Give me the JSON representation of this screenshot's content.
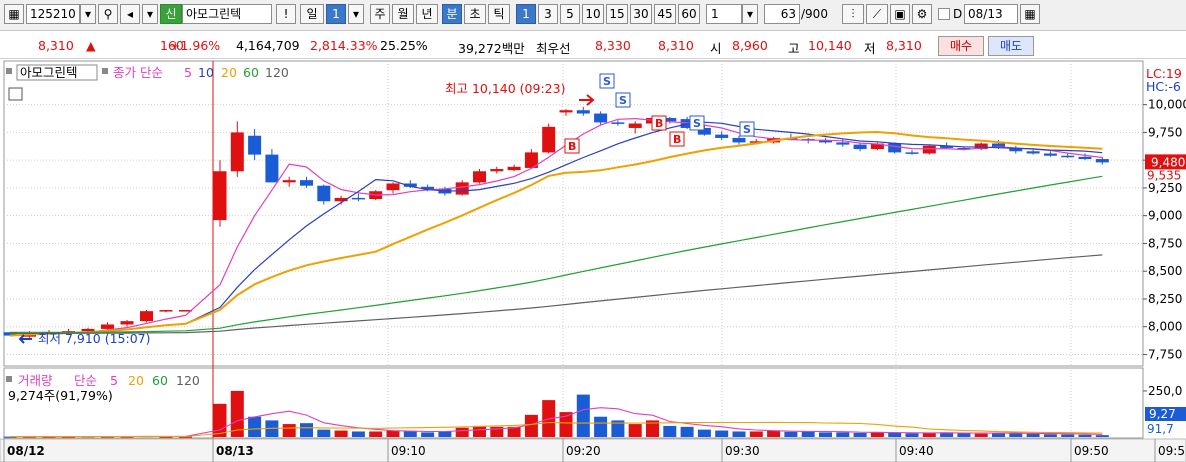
{
  "toolbar": {
    "code": "125210",
    "credit_badge": "신",
    "stock_name": "아모그린텍",
    "alert": "!",
    "period_tabs": [
      "일",
      "1",
      "주",
      "월",
      "년",
      "분",
      "초",
      "틱"
    ],
    "intervals": [
      "1",
      "3",
      "5",
      "10",
      "15",
      "30",
      "45",
      "60"
    ],
    "interval_value": "1",
    "count": "63",
    "count_max": "/900",
    "date_check": "D",
    "date": "08/13"
  },
  "quote": {
    "price": "8,310",
    "change_arrow": "▲",
    "change": "160",
    "change_pct": "+1.96%",
    "volume": "4,164,709",
    "vol_ratio": "2,814.33%",
    "turnover": "25.25%",
    "amount": "39,272백만",
    "best_label": "최우선",
    "best_ask": "8,330",
    "best_bid": "8,310",
    "open_label": "시",
    "open": "8,960",
    "high_label": "고",
    "high": "10,140",
    "low_label": "저",
    "low": "8,310",
    "buy": "매수",
    "sell": "매도"
  },
  "chart_data": {
    "type": "candlestick",
    "legend": {
      "name": "아모그린텍",
      "ma_label": "종가 단순",
      "ma_periods": [
        "5",
        "10",
        "20",
        "60",
        "120"
      ]
    },
    "colors": {
      "up": "#e01010",
      "down": "#1a5cd6",
      "ma5": "#e040c0",
      "ma10": "#2840c0",
      "ma20": "#f0a000",
      "ma60": "#20a030",
      "ma120": "#606060"
    },
    "price_axis": {
      "ticks": [
        "10,000",
        "9,750",
        "9,500",
        "9,250",
        "9,000",
        "8,750",
        "8,500",
        "8,250",
        "8,000",
        "7,750"
      ],
      "range": [
        7700,
        10150
      ],
      "current": "9,480",
      "current_sub": "9,535",
      "lc_label": "LC:19",
      "hc_label": "HC:-6"
    },
    "annotations": {
      "high": "최고 10,140 (09:23)",
      "low": "최저 7,910 (15:07)",
      "signals": [
        "S",
        "S",
        "S",
        "S",
        "B",
        "B",
        "B"
      ]
    },
    "x_labels": [
      "08/12",
      "08/13",
      "09:10",
      "09:20",
      "09:30",
      "09:40",
      "09:50",
      "09:5"
    ],
    "candles": [
      [
        7950,
        7950,
        7920,
        7920
      ],
      [
        7910,
        7960,
        7900,
        7940
      ],
      [
        7940,
        7970,
        7930,
        7950
      ],
      [
        7950,
        7980,
        7940,
        7960
      ],
      [
        7960,
        7990,
        7950,
        7980
      ],
      [
        7980,
        8040,
        7970,
        8020
      ],
      [
        8020,
        8060,
        8000,
        8050
      ],
      [
        8050,
        8150,
        8040,
        8140
      ],
      [
        8140,
        8150,
        8130,
        8150
      ],
      [
        8150,
        8150,
        8150,
        8150
      ],
      [
        8960,
        9500,
        8900,
        9400
      ],
      [
        9400,
        9850,
        9350,
        9750
      ],
      [
        9720,
        9780,
        9500,
        9550
      ],
      [
        9550,
        9600,
        9300,
        9300
      ],
      [
        9300,
        9350,
        9260,
        9320
      ],
      [
        9320,
        9350,
        9250,
        9270
      ],
      [
        9270,
        9280,
        9100,
        9130
      ],
      [
        9130,
        9180,
        9100,
        9160
      ],
      [
        9160,
        9200,
        9130,
        9150
      ],
      [
        9150,
        9230,
        9140,
        9220
      ],
      [
        9230,
        9300,
        9200,
        9290
      ],
      [
        9290,
        9320,
        9250,
        9260
      ],
      [
        9260,
        9280,
        9220,
        9240
      ],
      [
        9240,
        9260,
        9180,
        9200
      ],
      [
        9190,
        9320,
        9180,
        9300
      ],
      [
        9300,
        9420,
        9290,
        9400
      ],
      [
        9400,
        9440,
        9380,
        9420
      ],
      [
        9410,
        9460,
        9400,
        9440
      ],
      [
        9430,
        9600,
        9420,
        9570
      ],
      [
        9570,
        9830,
        9560,
        9800
      ],
      [
        9930,
        9960,
        9900,
        9950
      ],
      [
        9950,
        9980,
        9900,
        9920
      ],
      [
        9920,
        9940,
        9820,
        9840
      ],
      [
        9840,
        9860,
        9810,
        9830
      ],
      [
        9790,
        9850,
        9740,
        9830
      ],
      [
        9830,
        9890,
        9810,
        9880
      ],
      [
        9880,
        9890,
        9830,
        9850
      ],
      [
        9870,
        9890,
        9780,
        9790
      ],
      [
        9790,
        9820,
        9720,
        9730
      ],
      [
        9730,
        9760,
        9680,
        9700
      ],
      [
        9700,
        9720,
        9640,
        9660
      ],
      [
        9660,
        9690,
        9640,
        9670
      ],
      [
        9660,
        9710,
        9650,
        9700
      ],
      [
        9700,
        9740,
        9680,
        9690
      ],
      [
        9690,
        9700,
        9650,
        9680
      ],
      [
        9680,
        9700,
        9650,
        9660
      ],
      [
        9660,
        9690,
        9620,
        9640
      ],
      [
        9640,
        9660,
        9580,
        9600
      ],
      [
        9600,
        9660,
        9590,
        9650
      ],
      [
        9650,
        9660,
        9560,
        9570
      ],
      [
        9570,
        9590,
        9550,
        9560
      ],
      [
        9560,
        9640,
        9550,
        9630
      ],
      [
        9630,
        9660,
        9600,
        9610
      ],
      [
        9610,
        9620,
        9590,
        9600
      ],
      [
        9600,
        9660,
        9590,
        9650
      ],
      [
        9650,
        9680,
        9600,
        9610
      ],
      [
        9610,
        9630,
        9560,
        9580
      ],
      [
        9580,
        9600,
        9550,
        9560
      ],
      [
        9560,
        9580,
        9530,
        9540
      ],
      [
        9540,
        9560,
        9520,
        9530
      ],
      [
        9530,
        9560,
        9500,
        9510
      ],
      [
        9510,
        9530,
        9460,
        9480
      ]
    ],
    "volume_axis": {
      "ticks": [
        "250,0"
      ],
      "range": [
        0,
        320
      ],
      "current": "9,27",
      "current_sub": "91,7"
    },
    "volume_legend": {
      "name": "거래량",
      "ma_label": "단순",
      "ma_periods": [
        "5",
        "20",
        "60",
        "120"
      ],
      "value": "9,274주(91,79%)"
    },
    "volumes": [
      2,
      3,
      2,
      2,
      4,
      3,
      3,
      5,
      2,
      2,
      180,
      250,
      110,
      90,
      70,
      75,
      40,
      35,
      30,
      30,
      35,
      30,
      25,
      30,
      50,
      60,
      55,
      55,
      120,
      200,
      135,
      230,
      110,
      90,
      70,
      90,
      60,
      55,
      40,
      35,
      30,
      30,
      35,
      28,
      30,
      25,
      25,
      22,
      25,
      22,
      20,
      22,
      25,
      20,
      18,
      20,
      22,
      18,
      15,
      14,
      12,
      10
    ]
  }
}
